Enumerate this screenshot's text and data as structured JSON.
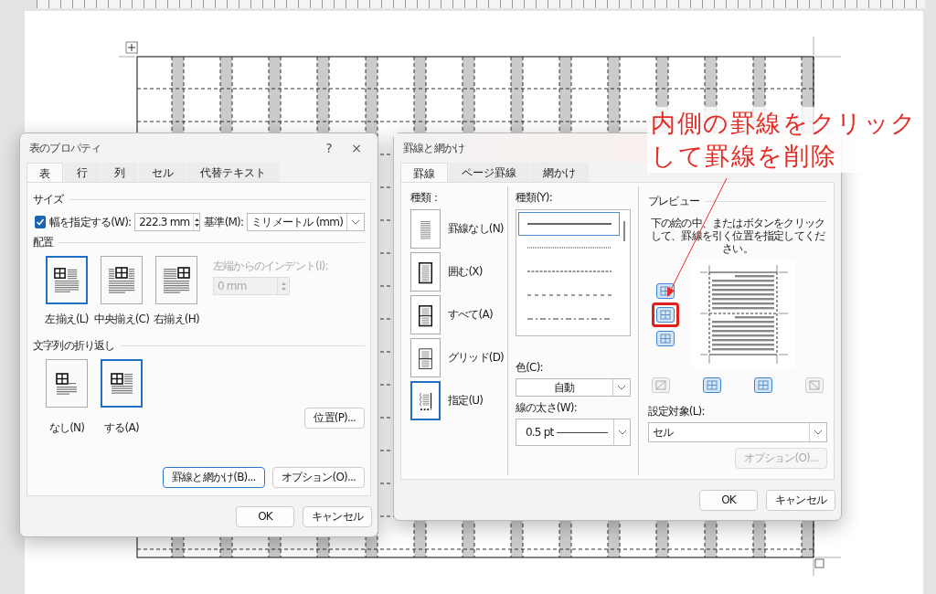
{
  "table_properties": {
    "title": "表のプロパティ",
    "help": "?",
    "close": "×",
    "tabs": [
      {
        "label": "表",
        "selected": true
      },
      {
        "label": "行",
        "selected": false
      },
      {
        "label": "列",
        "selected": false
      },
      {
        "label": "セル",
        "selected": false
      },
      {
        "label": "代替テキスト",
        "selected": false
      }
    ],
    "size": {
      "heading": "サイズ",
      "width_checkbox": {
        "label": "幅を指定する(W):",
        "checked": true
      },
      "width_value": "222.3 mm",
      "unit_label": "基準(M):",
      "unit_value": "ミリメートル (mm)"
    },
    "alignment": {
      "heading": "配置",
      "options": [
        {
          "kind": "left",
          "label": "左揃え(L)",
          "selected": true
        },
        {
          "kind": "center",
          "label": "中央揃え(C)",
          "selected": false
        },
        {
          "kind": "right",
          "label": "右揃え(H)",
          "selected": false
        }
      ],
      "indent": {
        "label": "左端からのインデント(I):",
        "value": "0 mm",
        "disabled": true
      }
    },
    "wrapping": {
      "heading": "文字列の折り返し",
      "options": [
        {
          "kind": "none",
          "label": "なし(N)",
          "selected": false
        },
        {
          "kind": "around",
          "label": "する(A)",
          "selected": true
        }
      ]
    },
    "position_button": "位置(P)...",
    "action_buttons": [
      {
        "label": "罫線と網かけ(B)...",
        "default": true
      },
      {
        "label": "オプション(O)...",
        "default": false
      }
    ],
    "footer_buttons": [
      "OK",
      "キャンセル"
    ]
  },
  "borders_and_shading": {
    "title": "罫線と網かけ",
    "tabs": [
      {
        "label": "罫線",
        "selected": true
      },
      {
        "label": "ページ罫線",
        "selected": false
      },
      {
        "label": "網かけ",
        "selected": false
      }
    ],
    "setting": {
      "heading": "種類：",
      "options": [
        {
          "kind": "none",
          "label": "罫線なし(N)",
          "selected": false
        },
        {
          "kind": "box",
          "label": "囲む(X)",
          "selected": false
        },
        {
          "kind": "all",
          "label": "すべて(A)",
          "selected": false
        },
        {
          "kind": "grid",
          "label": "グリッド(D)",
          "selected": false
        },
        {
          "kind": "custom",
          "label": "指定(U)",
          "selected": true
        }
      ]
    },
    "style": {
      "heading": "種類(Y):",
      "line_styles": [
        {
          "kind": "solid",
          "selected": true
        },
        {
          "kind": "dotted",
          "selected": false
        },
        {
          "kind": "dashed",
          "selected": false
        },
        {
          "kind": "long-dash",
          "selected": false
        },
        {
          "kind": "dash-dot",
          "selected": false
        }
      ],
      "color_label": "色(C):",
      "color_value": "自動",
      "width_label": "線の太さ(W):",
      "width_value": "0.5 pt"
    },
    "preview": {
      "heading": "プレビュー",
      "instructions": "下の絵の中、またはボタンをクリックして、罫線を引く位置を指定してください。",
      "side_buttons": [
        {
          "kind": "grid",
          "on": true,
          "annotated": false
        },
        {
          "kind": "grid",
          "on": true,
          "annotated": true
        },
        {
          "kind": "grid",
          "on": true,
          "annotated": false
        }
      ],
      "bottom_buttons": [
        {
          "kind": "diagonal-up",
          "on": false
        },
        {
          "kind": "grid",
          "on": true
        },
        {
          "kind": "grid",
          "on": true
        },
        {
          "kind": "diagonal-down",
          "on": false
        }
      ],
      "apply_to_label": "設定対象(L):",
      "apply_to_value": "セル",
      "options_button": {
        "label": "オプション(O)...",
        "disabled": true
      }
    },
    "footer_buttons": [
      "OK",
      "キャンセル"
    ]
  },
  "annotation": {
    "text": "内側の罫線をクリックして罫線を削除"
  }
}
